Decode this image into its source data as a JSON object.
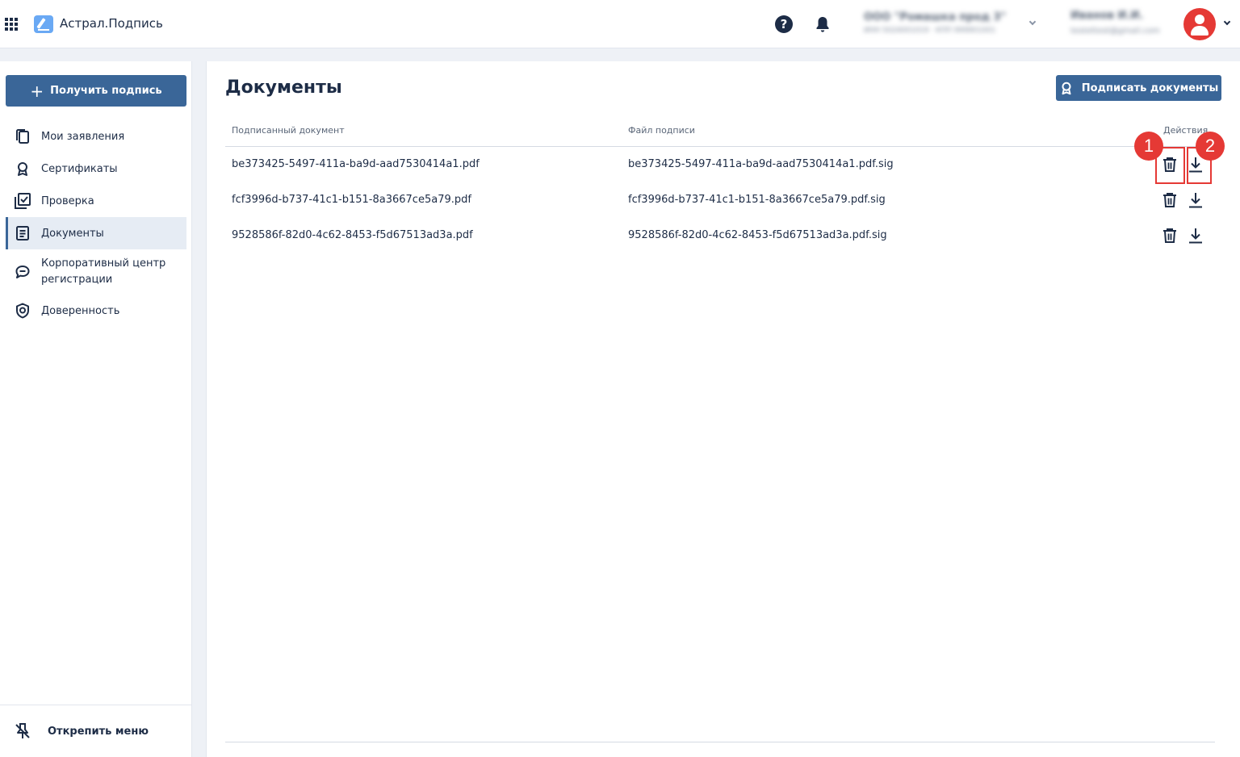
{
  "header": {
    "app_name": "Астрал.Подпись",
    "org_name": "ООО \"Ромашка прод 3\"",
    "org_details": "ИНН 5024001019 · КПП 999901001",
    "user_name": "Иванов И.И.",
    "user_email": "testettest@gmail.com"
  },
  "sidebar": {
    "get_signature_label": "Получить подпись",
    "items": [
      {
        "label": "Мои заявления",
        "icon": "copy-icon"
      },
      {
        "label": "Сертификаты",
        "icon": "ribbon-icon"
      },
      {
        "label": "Проверка",
        "icon": "check-docs-icon"
      },
      {
        "label": "Документы",
        "icon": "document-icon"
      },
      {
        "label": "Корпоративный центр регистрации",
        "icon": "chat-icon"
      },
      {
        "label": "Доверенность",
        "icon": "shield-icon"
      }
    ],
    "unpin_label": "Открепить меню"
  },
  "main": {
    "title": "Документы",
    "sign_docs_label": "Подписать документы",
    "columns": [
      "Подписанный документ",
      "Файл подписи",
      "Действия"
    ],
    "rows": [
      {
        "document": "be373425-5497-411a-ba9d-aad7530414a1.pdf",
        "signature": "be373425-5497-411a-ba9d-aad7530414a1.pdf.sig"
      },
      {
        "document": "fcf3996d-b737-41c1-b151-8a3667ce5a79.pdf",
        "signature": "fcf3996d-b737-41c1-b151-8a3667ce5a79.pdf.sig"
      },
      {
        "document": "9528586f-82d0-4c62-8453-f5d67513ad3a.pdf",
        "signature": "9528586f-82d0-4c62-8453-f5d67513ad3a.pdf.sig"
      }
    ]
  },
  "annotations": {
    "badge_1": "1",
    "badge_2": "2"
  },
  "colors": {
    "primary": "#3a6698",
    "text": "#1d2c46",
    "highlight": "#e53935"
  }
}
